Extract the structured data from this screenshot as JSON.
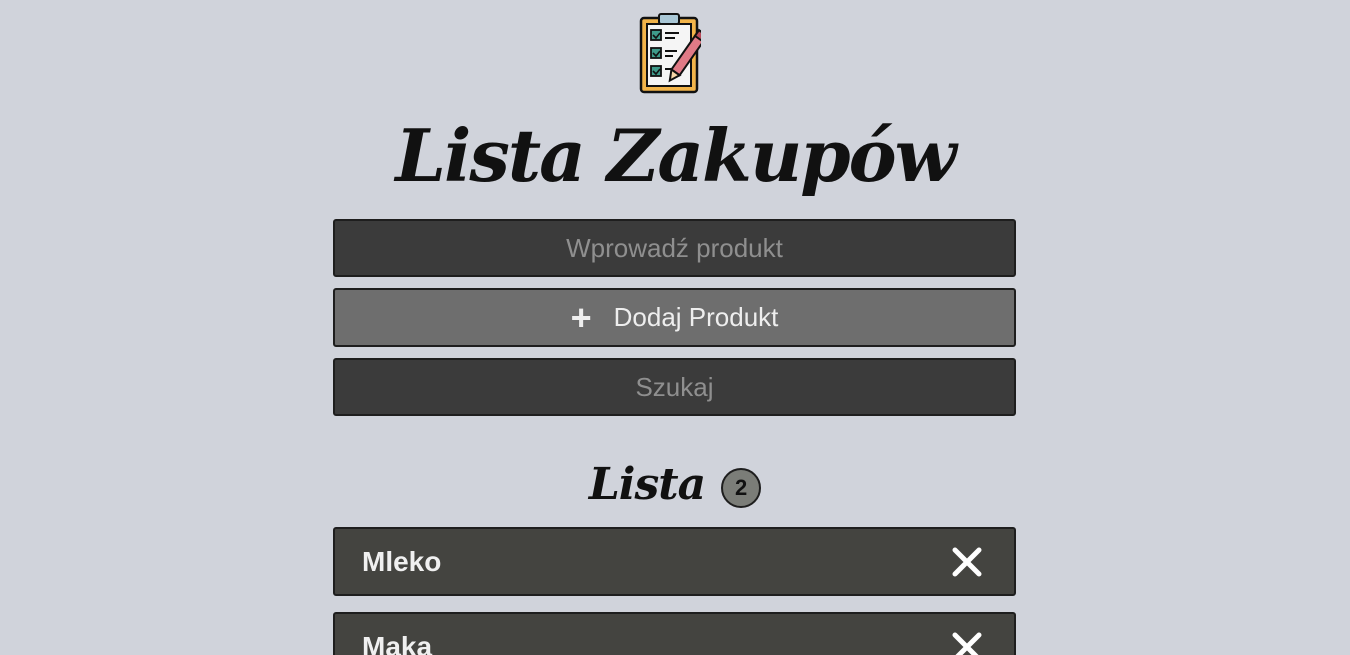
{
  "app": {
    "title": "Lista Zakupów",
    "logo_icon": "clipboard-checklist-icon"
  },
  "form": {
    "product_placeholder": "Wprowadź produkt",
    "add_button_label": "Dodaj Produkt",
    "add_icon": "+",
    "search_placeholder": "Szukaj"
  },
  "list": {
    "title": "Lista",
    "count": "2",
    "items": [
      {
        "label": "Mleko",
        "remove_icon": "close-icon"
      },
      {
        "label": "Maka",
        "remove_icon": "close-icon"
      }
    ]
  },
  "colors": {
    "background": "#d0d3db",
    "input_bg": "#3b3b3b",
    "button_bg": "#6e6e6e",
    "item_bg": "#444440"
  }
}
